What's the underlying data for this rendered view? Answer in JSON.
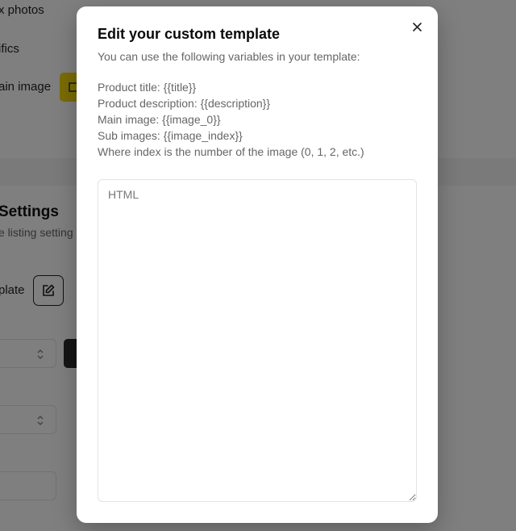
{
  "background": {
    "section1": {
      "rows": [
        {
          "label": "x photos"
        },
        {
          "label": "ifics"
        },
        {
          "label": "ain image"
        }
      ]
    },
    "section2": {
      "heading": "Settings",
      "subtitle": "e listing setting",
      "template_label": "plate"
    }
  },
  "modal": {
    "title": "Edit your custom template",
    "description": "You can use the following variables in your template:",
    "variables": [
      "Product title: {{title}}",
      "Product description: {{description}}",
      "Main image: {{image_0}}",
      "Sub images: {{image_index}}",
      "Where index is the number of the image (0, 1, 2, etc.)"
    ],
    "textarea": {
      "placeholder": "HTML",
      "value": ""
    },
    "close_icon": "close-icon"
  }
}
